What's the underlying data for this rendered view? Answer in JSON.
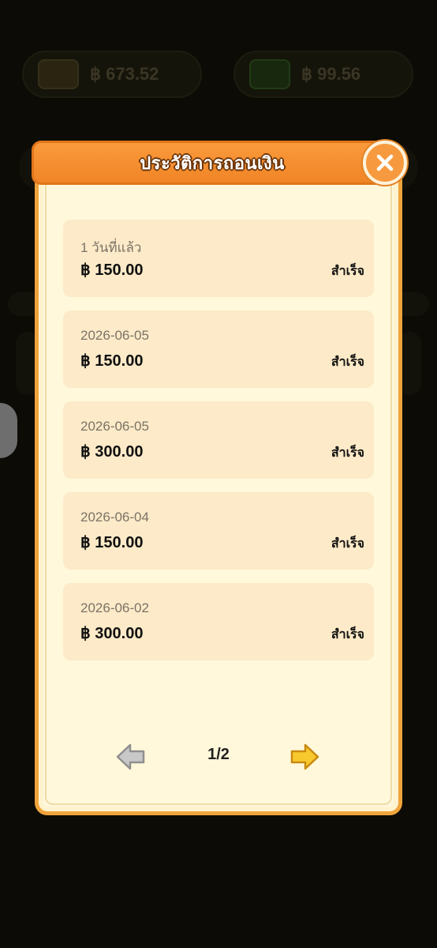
{
  "background": {
    "balances": [
      {
        "icon": "wallet-icon",
        "amount": "฿ 673.52"
      },
      {
        "icon": "cash-icon",
        "amount": "฿ 99.56"
      }
    ]
  },
  "dialog": {
    "title": "ประวัติการถอนเงิน",
    "close_icon": "close-icon",
    "records": [
      {
        "date": "1 วันที่แล้ว",
        "amount": "฿ 150.00",
        "status": "สำเร็จ"
      },
      {
        "date": "2026-06-05",
        "amount": "฿ 150.00",
        "status": "สำเร็จ"
      },
      {
        "date": "2026-06-05",
        "amount": "฿ 300.00",
        "status": "สำเร็จ"
      },
      {
        "date": "2026-06-04",
        "amount": "฿ 150.00",
        "status": "สำเร็จ"
      },
      {
        "date": "2026-06-02",
        "amount": "฿ 300.00",
        "status": "สำเร็จ"
      }
    ],
    "pagination": {
      "current": "1/2",
      "prev_icon": "arrow-left-icon",
      "next_icon": "arrow-right-icon",
      "prev_enabled": false,
      "next_enabled": true
    }
  },
  "colors": {
    "header": "#f08526",
    "row_bg": "#fdeac8",
    "next_arrow": "#f7c52e",
    "prev_arrow_disabled": "#bdbdbd"
  }
}
